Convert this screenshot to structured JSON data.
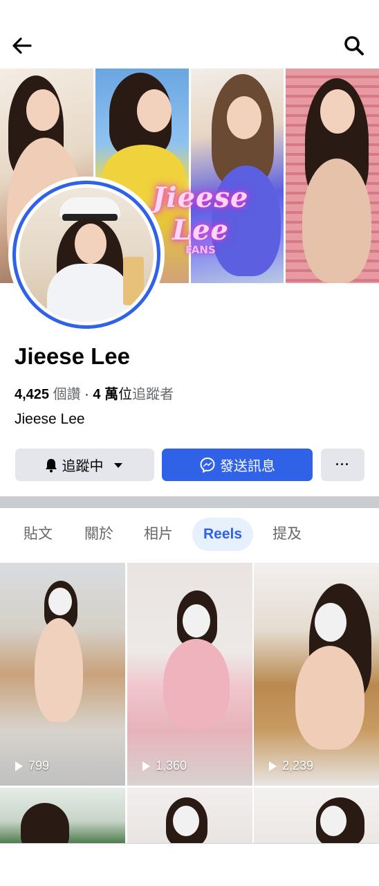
{
  "header": {
    "back_icon": "arrow-left-icon",
    "search_icon": "search-icon"
  },
  "cover": {
    "logo_line1": "Jieese Lee",
    "logo_line2": "FANS"
  },
  "profile": {
    "name": "Jieese Lee",
    "likes_count": "4,425",
    "likes_label": " 個讚",
    "separator": " · ",
    "followers_count": "4 萬",
    "followers_unit": "位",
    "followers_label": "追蹤者",
    "bio": "Jieese Lee"
  },
  "actions": {
    "follow_label": "追蹤中",
    "message_label": "發送訊息",
    "more_label": "···"
  },
  "tabs": [
    {
      "label": "貼文",
      "active": false
    },
    {
      "label": "關於",
      "active": false
    },
    {
      "label": "相片",
      "active": false
    },
    {
      "label": "Reels",
      "active": true
    },
    {
      "label": "提及",
      "active": false
    }
  ],
  "reels": [
    {
      "views": "799"
    },
    {
      "views": "1,360"
    },
    {
      "views": "2,239"
    }
  ],
  "colors": {
    "accent": "#2f62e6",
    "tab_active_bg": "#e7f0fd",
    "button_gray": "#e4e6eb"
  }
}
